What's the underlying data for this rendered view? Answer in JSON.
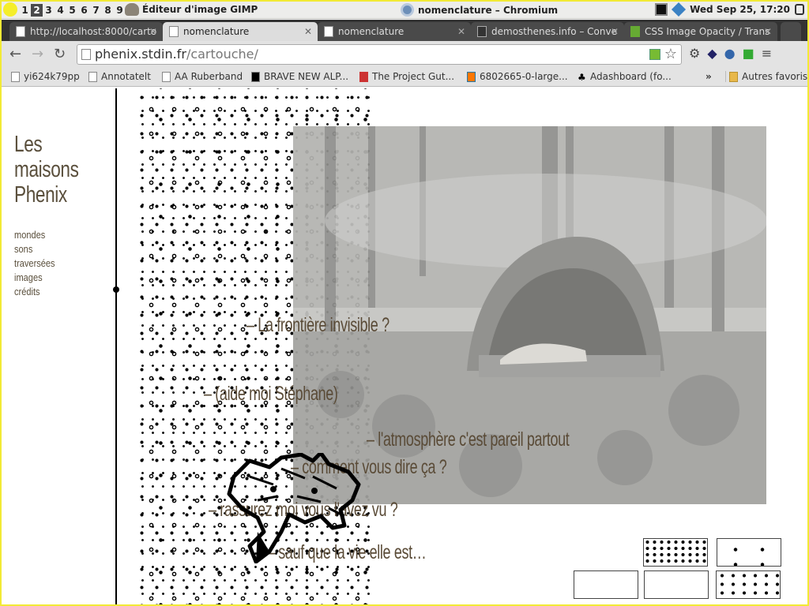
{
  "desktop": {
    "workspaces": [
      "1",
      "2",
      "3",
      "4",
      "5",
      "6",
      "7",
      "8",
      "9"
    ],
    "active_workspace": "2",
    "gimp_title": "Éditeur d'image GIMP",
    "chromium_title": "nomenclature – Chromium",
    "clock": "Wed Sep 25, 17:20"
  },
  "browser": {
    "tabs": [
      {
        "label": "http://localhost:8000/carto"
      },
      {
        "label": "nomenclature"
      },
      {
        "label": "nomenclature"
      },
      {
        "label": "demosthenes.info – Conve"
      },
      {
        "label": "CSS Image Opacity / Trans"
      }
    ],
    "url_host": "phenix.stdin.fr",
    "url_path": "/cartouche/",
    "bookmarks": [
      {
        "label": "yi624k79pp"
      },
      {
        "label": "Annotatelt"
      },
      {
        "label": "AA Ruberband"
      },
      {
        "label": "BRAVE NEW ALP..."
      },
      {
        "label": "The Project Gut..."
      },
      {
        "label": "6802665-0-large..."
      },
      {
        "label": "Adashboard (fo..."
      }
    ],
    "bookmarks_overflow": "»",
    "other_bookmarks": "Autres favoris"
  },
  "site": {
    "title": [
      "Les",
      "maisons",
      "Phenix"
    ],
    "menu": [
      "mondes",
      "sons",
      "traversées",
      "images",
      "crédits"
    ]
  },
  "phrases": [
    "– La frontière invisible ?",
    "– (aide moi Stéphane)",
    "– l'atmosphère c'est pareil partout",
    "– comment vous dire ça ?",
    "– rassurez moi vous l'avez vu ?",
    "– sauf que la vie elle est…"
  ],
  "icons": {
    "back": "back-arrow-icon",
    "forward": "forward-arrow-icon",
    "reload": "reload-icon",
    "star": "bookmark-star-icon",
    "menu": "hamburger-menu-icon"
  },
  "colors": {
    "accent_yellow": "#f2ea35",
    "text_brown": "#5a4b37"
  }
}
